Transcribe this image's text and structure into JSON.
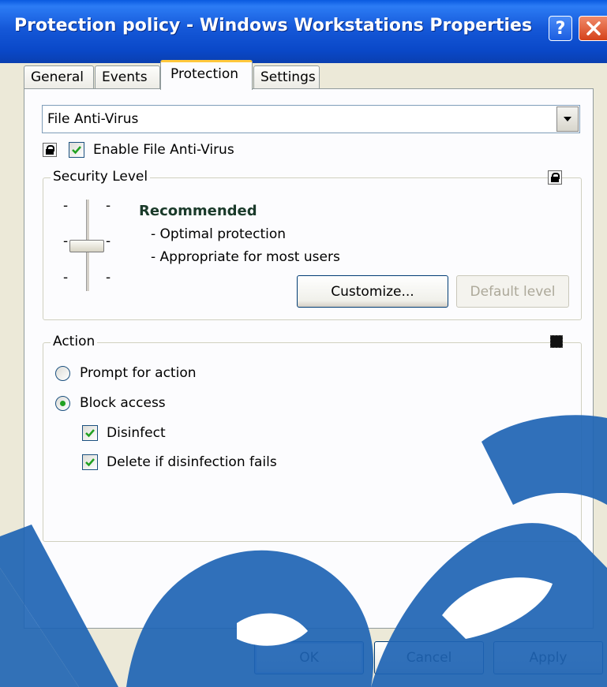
{
  "window": {
    "title": "Protection policy - Windows Workstations Properties",
    "help_glyph": "?",
    "close_icon": "close-icon"
  },
  "tabs": [
    {
      "label": "General"
    },
    {
      "label": "Events"
    },
    {
      "label": "Protection",
      "active": true
    },
    {
      "label": "Settings"
    }
  ],
  "component_select": {
    "value": "File Anti-Virus"
  },
  "enable": {
    "label": "Enable File Anti-Virus",
    "checked": true
  },
  "security_level": {
    "title": "Security Level",
    "level_name": "Recommended",
    "desc_1": "- Optimal protection",
    "desc_2": "- Appropriate for most users",
    "slider_ticks": [
      "-",
      "-",
      "-",
      "-",
      "-",
      "-"
    ],
    "customize_label": "Customize...",
    "default_label": "Default level"
  },
  "action": {
    "title": "Action",
    "prompt_label": "Prompt for action",
    "block_label": "Block access",
    "selected": "Block access",
    "disinfect_label": "Disinfect",
    "disinfect_checked": true,
    "delete_label": "Delete if disinfection fails",
    "delete_checked": true
  },
  "buttons": {
    "ok": "OK",
    "cancel": "Cancel",
    "apply": "Apply"
  },
  "colors": {
    "titlebar": "#0a48c8",
    "dialog_bg": "#ece9d8",
    "accent_tab": "#ffc83c",
    "check_green": "#21a121",
    "level_text": "#1a3a2a",
    "watermark": "#1e64b4"
  }
}
